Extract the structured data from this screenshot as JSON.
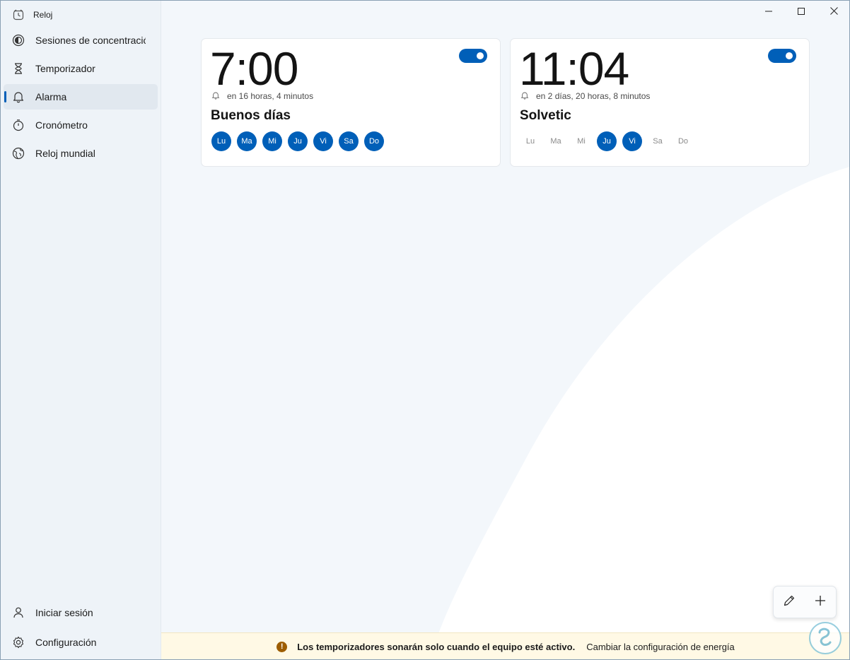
{
  "app": {
    "title": "Reloj",
    "icon": "clock-app-icon"
  },
  "sidebar": {
    "items": [
      {
        "label": "Sesiones de concentració",
        "icon": "focus-icon",
        "selected": false
      },
      {
        "label": "Temporizador",
        "icon": "hourglass-icon",
        "selected": false
      },
      {
        "label": "Alarma",
        "icon": "bell-icon",
        "selected": true
      },
      {
        "label": "Cronómetro",
        "icon": "stopwatch-icon",
        "selected": false
      },
      {
        "label": "Reloj mundial",
        "icon": "globe-icon",
        "selected": false
      }
    ],
    "bottom_items": [
      {
        "label": "Iniciar sesión",
        "icon": "person-icon"
      },
      {
        "label": "Configuración",
        "icon": "gear-icon"
      }
    ]
  },
  "window_controls": {
    "minimize": "minimize-icon",
    "maximize": "maximize-icon",
    "close": "close-icon"
  },
  "alarms": [
    {
      "time": "7:00",
      "remaining": "en 16 horas, 4 minutos",
      "name": "Buenos días",
      "enabled": true,
      "days": [
        {
          "label": "Lu",
          "active": true
        },
        {
          "label": "Ma",
          "active": true
        },
        {
          "label": "Mi",
          "active": true
        },
        {
          "label": "Ju",
          "active": true
        },
        {
          "label": "Vi",
          "active": true
        },
        {
          "label": "Sa",
          "active": true
        },
        {
          "label": "Do",
          "active": true
        }
      ]
    },
    {
      "time": "11:04",
      "remaining": "en 2 días, 20 horas, 8 minutos",
      "name": "Solvetic",
      "enabled": true,
      "days": [
        {
          "label": "Lu",
          "active": false
        },
        {
          "label": "Ma",
          "active": false
        },
        {
          "label": "Mi",
          "active": false
        },
        {
          "label": "Ju",
          "active": true
        },
        {
          "label": "Vi",
          "active": true
        },
        {
          "label": "Sa",
          "active": false
        },
        {
          "label": "Do",
          "active": false
        }
      ]
    }
  ],
  "fab": {
    "edit_icon": "pencil-icon",
    "add_icon": "plus-icon"
  },
  "infobar": {
    "message": "Los temporizadores sonarán solo cuando el equipo esté activo.",
    "link": "Cambiar la configuración de energía",
    "icon": "warning-icon"
  },
  "colors": {
    "accent": "#005fb8",
    "infobar_bg": "#fff9e5",
    "warning": "#9d5d00"
  }
}
